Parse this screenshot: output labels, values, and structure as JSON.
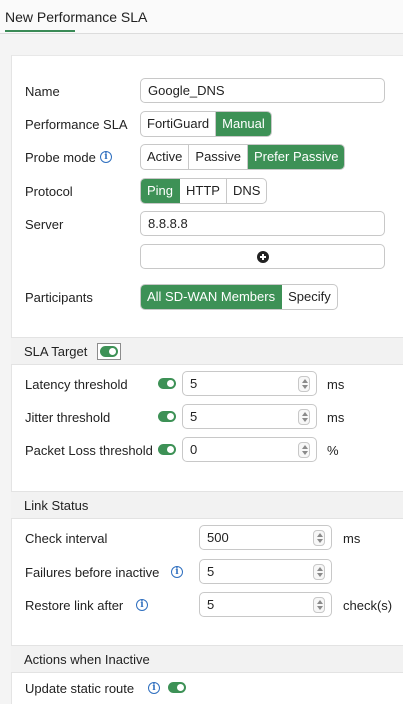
{
  "window": {
    "title": "New Performance SLA"
  },
  "form": {
    "name_label": "Name",
    "name_value": "Google_DNS",
    "sla_label": "Performance SLA",
    "sla_options": [
      "FortiGuard",
      "Manual"
    ],
    "sla_selected": "Manual",
    "probe_label": "Probe mode",
    "probe_options": [
      "Active",
      "Passive",
      "Prefer Passive"
    ],
    "probe_selected": "Prefer Passive",
    "protocol_label": "Protocol",
    "protocol_options": [
      "Ping",
      "HTTP",
      "DNS"
    ],
    "protocol_selected": "Ping",
    "server_label": "Server",
    "server_value": "8.8.8.8",
    "participants_label": "Participants",
    "participants_options": [
      "All SD-WAN Members",
      "Specify"
    ],
    "participants_selected": "All SD-WAN Members"
  },
  "sla_target": {
    "title": "SLA Target",
    "enabled": true,
    "latency_label": "Latency threshold",
    "latency_value": "5",
    "latency_unit": "ms",
    "jitter_label": "Jitter threshold",
    "jitter_value": "5",
    "jitter_unit": "ms",
    "packet_loss_label": "Packet Loss threshold",
    "packet_loss_value": "0",
    "packet_loss_unit": "%"
  },
  "link_status": {
    "title": "Link Status",
    "check_interval_label": "Check interval",
    "check_interval_value": "500",
    "check_interval_unit": "ms",
    "failures_label": "Failures before inactive",
    "failures_value": "5",
    "restore_label": "Restore link after",
    "restore_value": "5",
    "restore_unit": "check(s)"
  },
  "actions": {
    "title": "Actions when Inactive",
    "update_static_route_label": "Update static route",
    "update_static_route_enabled": true
  },
  "colors": {
    "accent": "#3d9156",
    "info": "#2f6fbf"
  },
  "icons": [
    "info-icon",
    "plus-circle-icon",
    "toggle-switch-icon",
    "spinner-arrows-icon"
  ]
}
